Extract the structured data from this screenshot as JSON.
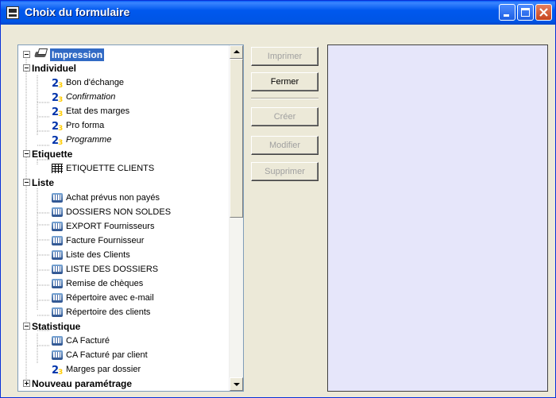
{
  "window": {
    "title": "Choix du formulaire"
  },
  "tree": {
    "root": "Impression",
    "individuel": {
      "label": "Individuel",
      "items": [
        "Bon d'échange",
        "Confirmation",
        "Etat des marges",
        "Pro forma",
        "Programme"
      ]
    },
    "etiquette": {
      "label": "Etiquette",
      "items": [
        "ETIQUETTE CLIENTS"
      ]
    },
    "liste": {
      "label": "Liste",
      "items": [
        "Achat prévus non payés",
        "DOSSIERS NON SOLDES",
        "EXPORT Fournisseurs",
        "Facture Fournisseur",
        "Liste des Clients",
        "LISTE DES DOSSIERS",
        "Remise de chèques",
        "Répertoire avec e-mail",
        "Répertoire des clients"
      ]
    },
    "statistique": {
      "label": "Statistique",
      "items": [
        "CA Facturé",
        "CA Facturé par client",
        "Marges par dossier"
      ]
    },
    "nouveau": {
      "label": "Nouveau paramétrage"
    }
  },
  "buttons": {
    "imprimer": "Imprimer",
    "fermer": "Fermer",
    "creer": "Créer",
    "modifier": "Modifier",
    "supprimer": "Supprimer"
  },
  "colors": {
    "titlebar": "#0058ee",
    "selection": "#316ac5",
    "preview_bg": "#e6e6fa"
  }
}
